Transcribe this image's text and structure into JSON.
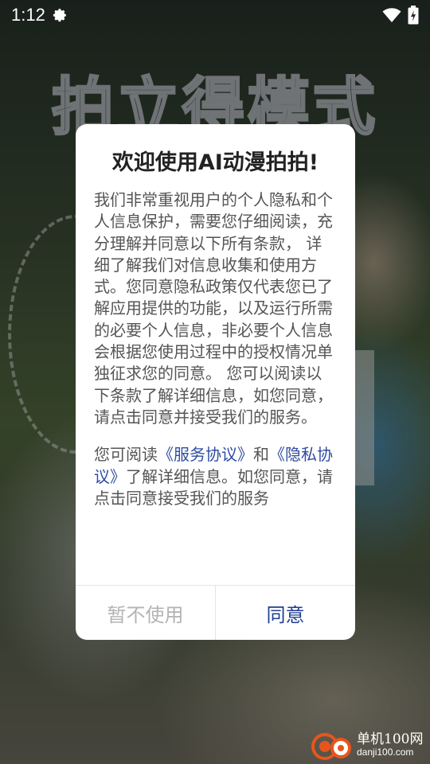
{
  "status_bar": {
    "time": "1:12",
    "icons": [
      "gear-icon",
      "wifi-icon",
      "battery-charging-icon"
    ]
  },
  "background": {
    "title": "拍立得模式"
  },
  "dialog": {
    "title": "欢迎使用AI动漫拍拍!",
    "paragraph1": "我们非常重视用户的个人隐私和个人信息保护，需要您仔细阅读，充分理解并同意以下所有条款， 详细了解我们对信息收集和使用方式。您同意隐私政策仅代表您已了解应用提供的功能，以及运行所需的必要个人信息，非必要个人信息会根据您使用过程中的授权情况单独征求您的同意。 您可以阅读以下条款了解详细信息，如您同意，请点击同意并接受我们的服务。",
    "paragraph2_prefix": "您可阅读",
    "service_link": "《服务协议》",
    "and": "和",
    "privacy_link": "《隐私协议》",
    "paragraph2_suffix": "了解详细信息。如您同意，请点击同意接受我们的服务",
    "cancel_label": "暂不使用",
    "agree_label": "同意"
  },
  "watermark": {
    "title": "单机100网",
    "url": "danji100.com"
  },
  "colors": {
    "link": "#2f4ca3",
    "agree": "#1f3f8f",
    "cancel": "#b3b3b3",
    "body_text": "#555555"
  }
}
